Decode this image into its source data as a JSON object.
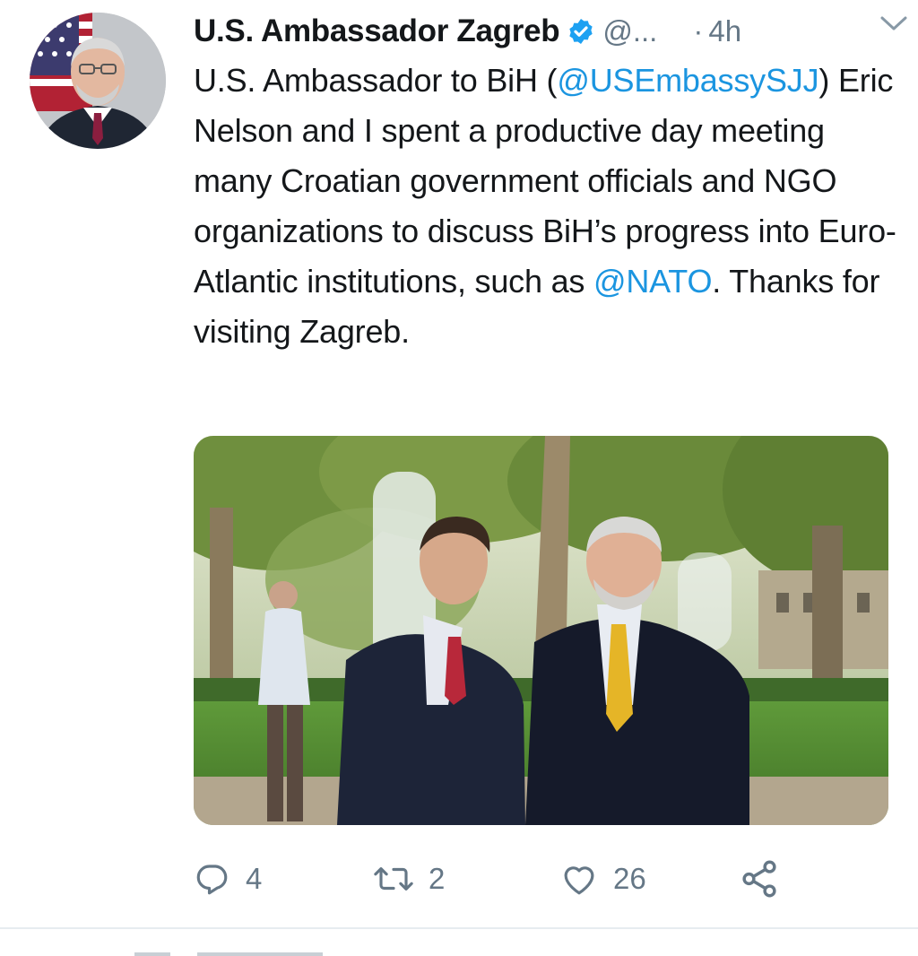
{
  "author": {
    "name": "U.S. Ambassador Zagreb",
    "handle": "@...",
    "separator": "·",
    "time": "4h"
  },
  "tweet": {
    "text_parts": {
      "p1": "U.S. Ambassador to BiH (",
      "m1": "@USEmbassySJJ",
      "p2": ") Eric Nelson and I spent a productive day meeting many Croatian government officials and NGO organizations to discuss BiH’s progress into Euro-Atlantic institutions, such as ",
      "m2": "@NATO",
      "p3": ". Thanks for visiting Zagreb."
    }
  },
  "actions": {
    "reply_count": "4",
    "retweet_count": "2",
    "like_count": "26"
  },
  "icons": {
    "verified": "verified-badge-icon",
    "menu": "chevron-down-icon",
    "reply": "reply-icon",
    "retweet": "retweet-icon",
    "like": "heart-icon",
    "share": "share-icon"
  },
  "colors": {
    "link": "#1b95e0",
    "secondary_text": "#657786",
    "verified": "#1da1f2"
  }
}
